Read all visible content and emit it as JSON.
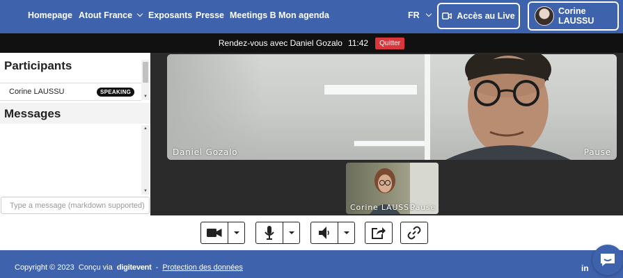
{
  "nav": {
    "items": [
      {
        "label": "Homepage"
      },
      {
        "label": "Atout France",
        "has_dropdown": true
      },
      {
        "label": "Exposants"
      },
      {
        "label": "Presse"
      },
      {
        "label": "Meetings B"
      },
      {
        "label": "Mon agenda"
      }
    ],
    "language": "FR",
    "live_button": "Accès au Live",
    "user_name": "Corine LAUSSU"
  },
  "meeting": {
    "title": "Rendez-vous avec Daniel Gozalo",
    "time": "11:42",
    "quit_label": "Quitter"
  },
  "participants": {
    "title": "Participants",
    "items": [
      {
        "name": "Corine LAUSSU",
        "badge": "SPEAKING"
      }
    ]
  },
  "messages": {
    "title": "Messages",
    "input_placeholder": "Type a message (markdown supported)"
  },
  "videos": {
    "main": {
      "name": "Daniel Gozalo",
      "status": "Pause"
    },
    "small": {
      "name": "Corine LAUSSU",
      "status": "Pause"
    }
  },
  "controls": {
    "buttons": [
      "camera-icon",
      "microphone-icon",
      "speaker-icon",
      "share-screen-icon",
      "link-icon"
    ]
  },
  "footer": {
    "copyright": "Copyright © 2023",
    "made_with": "Conçu via",
    "brand": "digitevent",
    "separator": "-",
    "privacy_link": "Protection des données",
    "social": "in"
  },
  "colors": {
    "brand_blue": "#3f62ad",
    "quit_red": "#d9363e",
    "video_bg": "#2b2b2b"
  }
}
